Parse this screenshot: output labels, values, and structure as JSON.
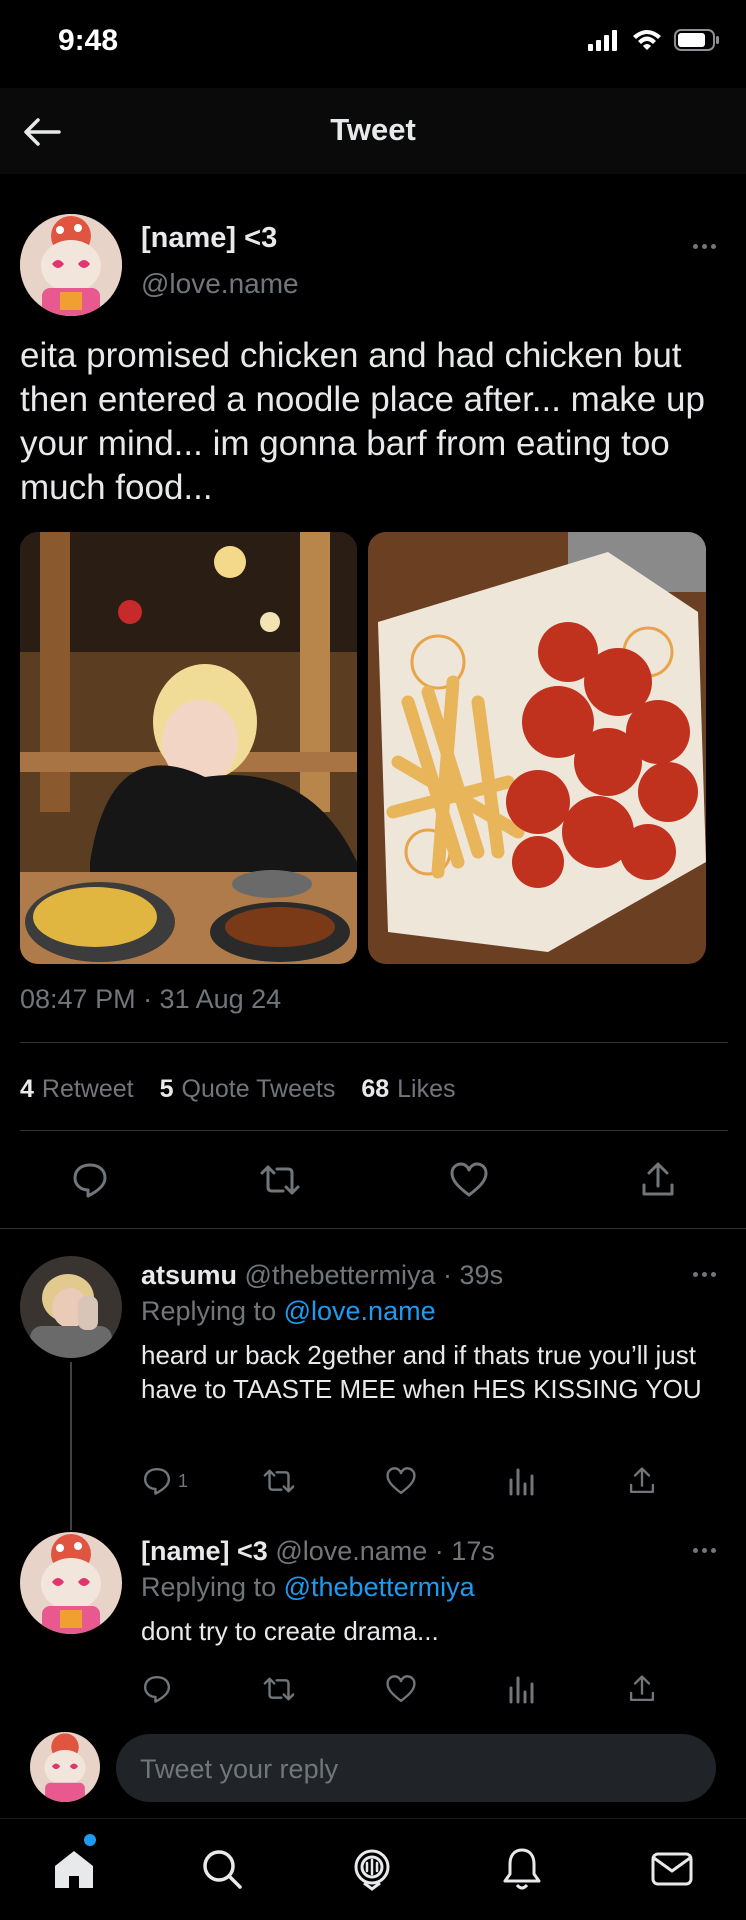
{
  "status": {
    "time": "9:48"
  },
  "nav": {
    "title": "Tweet"
  },
  "tweet": {
    "author_name": "[name] <3",
    "author_handle": "@love.name",
    "text": "eita promised chicken and had chicken but then entered a noodle place after... make up your mind... im gonna barf from eating too much food...",
    "timestamp": "08:47 PM · 31 Aug 24",
    "stats": {
      "retweets": "4",
      "retweets_label": "Retweet",
      "quotes": "5",
      "quotes_label": "Quote Tweets",
      "likes": "68",
      "likes_label": "Likes"
    },
    "photos": [
      "photo of blonde person eating noodles in restaurant",
      "photo of fried chicken with fries"
    ]
  },
  "replies": [
    {
      "name": "atsumu",
      "meta": "@thebettermiya · 39s",
      "replying_prefix": "Replying to",
      "replying_to": "@love.name",
      "text": "heard ur back 2gether and if thats true you’ll just have to TAASTE MEE when HES KISSING YOU",
      "reply_count": "1"
    },
    {
      "name": "[name] <3",
      "meta": "@love.name · 17s",
      "replying_prefix": "Replying to",
      "replying_to": "@thebettermiya",
      "text": "dont try to create drama...",
      "reply_count": ""
    }
  ],
  "composer": {
    "placeholder": "Tweet your reply"
  },
  "tabs": [
    "home-icon",
    "search-icon",
    "spaces-icon",
    "notifications-icon",
    "messages-icon"
  ],
  "colors": {
    "accent": "#1d9bf0",
    "background": "#000000",
    "secondary_text": "#71767b"
  }
}
